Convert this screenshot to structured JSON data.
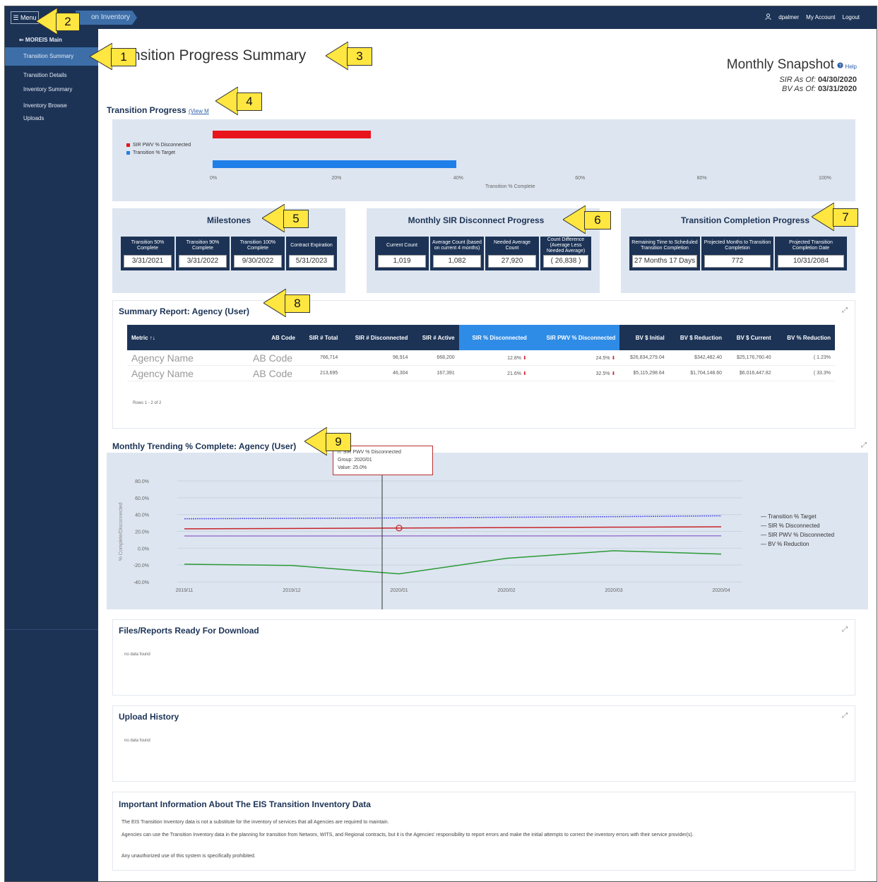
{
  "topbar": {
    "menu_label": "☰ Menu",
    "breadcrumb": "on Inventory",
    "user_name": "dpalmer",
    "my_account": "My Account",
    "logout": "Logout"
  },
  "sidebar": {
    "header": "⇐ MOREIS Main",
    "items": [
      "Transition Summary",
      "Transition Details",
      "Inventory Summary",
      "Inventory Browse",
      "Uploads"
    ]
  },
  "page": {
    "title": "nsition Progress Summary",
    "snapshot_title": "Monthly Snapshot",
    "snapshot_help": "Help",
    "sir_as_of_label": "SIR As Of:",
    "sir_as_of_date": "04/30/2020",
    "bv_as_of_label": "BV As Of:",
    "bv_as_of_date": "03/31/2020"
  },
  "transition_progress": {
    "title": "Transition Progress",
    "view_link": "(View M",
    "legend": [
      "SIR PWV % Disconnected",
      "Transition % Target"
    ],
    "colors": {
      "sir": "#e8141c",
      "target": "#1f7fe8"
    },
    "ticks": [
      "0%",
      "20%",
      "40%",
      "60%",
      "80%",
      "100%"
    ],
    "xlabel": "Transition % Complete"
  },
  "chart_data": [
    {
      "type": "bar",
      "orientation": "horizontal",
      "xlabel": "Transition % Complete",
      "xlim": [
        0,
        100
      ],
      "series": [
        {
          "name": "SIR PWV % Disconnected",
          "values": [
            26
          ]
        },
        {
          "name": "Transition % Target",
          "values": [
            40
          ]
        }
      ]
    },
    {
      "type": "line",
      "categories": [
        "2019/11",
        "2019/12",
        "2020/01",
        "2020/02",
        "2020/03",
        "2020/04"
      ],
      "ylim": [
        -40,
        80
      ],
      "yticks": [
        "80.0%",
        "60.0%",
        "40.0%",
        "20.0%",
        "0.0%",
        "-20.0%",
        "-40.0%"
      ],
      "ylabel": "% Complete/Disconnected",
      "series": [
        {
          "name": "Transition % Target",
          "values": [
            35,
            35.5,
            36,
            36.8,
            37.5,
            38.5
          ]
        },
        {
          "name": "SIR % Disconnected",
          "values": [
            14.5,
            14.5,
            14.6,
            14.6,
            14.7,
            14.8
          ]
        },
        {
          "name": "SIR PWV % Disconnected",
          "values": [
            23,
            23.5,
            24,
            24.5,
            25,
            25.5
          ]
        },
        {
          "name": "BV % Reduction",
          "values": [
            -19,
            -20.5,
            -30.5,
            -12,
            -3,
            -7
          ]
        }
      ],
      "tooltip": {
        "series": "n: SIR PWV % Disconnected",
        "group": "Group: 2020/01",
        "value": "Value: 25.0%"
      }
    }
  ],
  "milestones": {
    "title": "Milestones",
    "cells": [
      {
        "label": "Transition 50% Complete",
        "value": "3/31/2021"
      },
      {
        "label": "Transition 90% Complete",
        "value": "3/31/2022"
      },
      {
        "label": "Transition 100% Complete",
        "value": "9/30/2022"
      },
      {
        "label": "Contract Expiration",
        "value": "5/31/2023"
      }
    ]
  },
  "monthly_sir": {
    "title": "Monthly SIR Disconnect Progress",
    "cells": [
      {
        "label": "Current Count",
        "value": "1,019"
      },
      {
        "label": "Average Count (based on current 4 months)",
        "value": "1,082"
      },
      {
        "label": "Needed Average Count",
        "value": "27,920"
      },
      {
        "label": "Count Difference (Average Less Needed Average)",
        "value": "( 26,838 )"
      }
    ]
  },
  "completion_progress": {
    "title": "Transition Completion Progress",
    "cells": [
      {
        "label": "Remaining Time to Scheduled Transition Completion",
        "value": "27 Months 17 Days"
      },
      {
        "label": "Projected Months to Transition Completion",
        "value": "772"
      },
      {
        "label": "Projected Transition Completion Date",
        "value": "10/31/2084"
      }
    ]
  },
  "summary_report": {
    "title": "Summary Report: Agency (User)",
    "headers": [
      "Metric ↑↓",
      "AB Code",
      "SIR # Total",
      "SIR # Disconnected",
      "SIR # Active",
      "SIR % Disconnected",
      "SIR PWV % Disconnected",
      "BV $ Initial",
      "BV $ Reduction",
      "BV $ Current",
      "BV % Reduction"
    ],
    "rows": [
      [
        "Agency Name",
        "AB Code",
        "766,714",
        "98,914",
        "668,200",
        "12.8%",
        "24.5%",
        "$26,834,279.04",
        "$342,482.40",
        "$25,176,760.40",
        "( 1.23%"
      ],
      [
        "Agency Name",
        "AB Code",
        "213,695",
        "46,304",
        "167,391",
        "21.6%",
        "32.5%",
        "$5,115,298.64",
        "$1,704,148.60",
        "$6,016,447.82",
        "( 33.3%"
      ]
    ],
    "footer": "Rows 1 - 2 of 2"
  },
  "monthly_trending": {
    "title": "Monthly Trending % Complete: Agency (User)",
    "colors": {
      "target": "#5757e8",
      "sir": "#9a78d0",
      "pwv": "#c8242a",
      "bv": "#2a9a36"
    }
  },
  "files": {
    "title": "Files/Reports Ready For Download",
    "empty": "no data found"
  },
  "upload_history": {
    "title": "Upload History",
    "empty": "no data found"
  },
  "info": {
    "title": "Important Information About The EIS Transition Inventory Data",
    "p1": "The EIS Transition Inventory data is not a substitute for the inventory of services that all Agencies are required to maintain.",
    "p2": "Agencies can use the Transition Inventory data in the planning for transition from Networx, WITS, and Regional contracts, but it is the Agencies' responsibility to report errors and make the initial attempts to correct the inventory errors with their service provider(s).",
    "p3": "Any unauthorized use of this system is specifically prohibited."
  },
  "callouts": [
    "1",
    "2",
    "3",
    "4",
    "5",
    "6",
    "7",
    "8",
    "9"
  ]
}
